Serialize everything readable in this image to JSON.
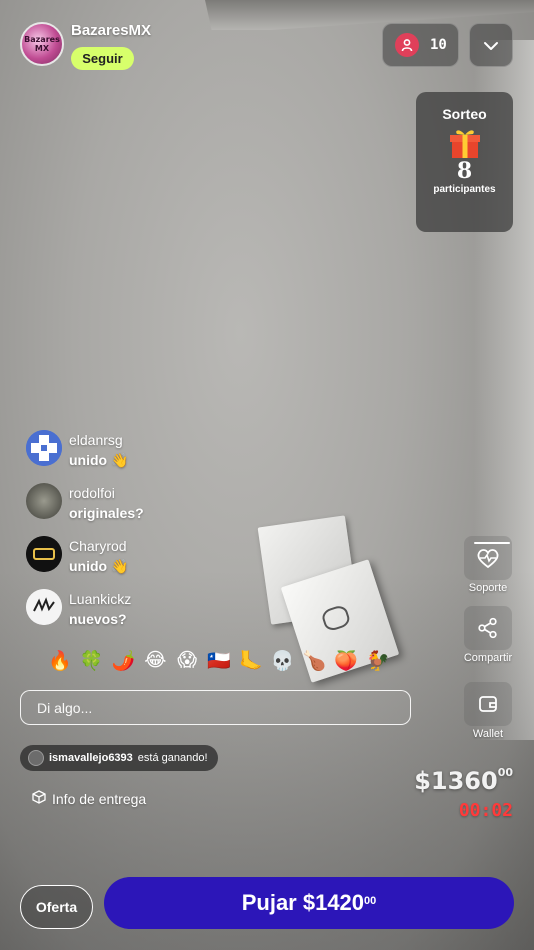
{
  "stream": {
    "host_name": "BazaresMX",
    "host_avatar_text": "Bazares MX",
    "follow_label": "Seguir",
    "viewer_count": "10"
  },
  "giveaway": {
    "title": "Sorteo",
    "icon": "gift-icon",
    "participants_count": "8",
    "participants_label": "participantes"
  },
  "chat": [
    {
      "user": "eldanrsg",
      "text": "unido 👋",
      "avatar": "blue-cross"
    },
    {
      "user": "rodolfoi",
      "text": "originales?",
      "avatar": "photo"
    },
    {
      "user": "Charyrod",
      "text": "unido 👋",
      "avatar": "rd-logo"
    },
    {
      "user": "Luankickz",
      "text": "nuevos?",
      "avatar": "white-logo"
    }
  ],
  "reactions": [
    "🔥",
    "🍀",
    "🌶️",
    "😂",
    "😱",
    "🇨🇱",
    "🦶",
    "💀",
    "🍗",
    "🍑",
    "🐓"
  ],
  "input": {
    "placeholder": "Di algo..."
  },
  "winner": {
    "user": "ismavallejo6393",
    "text": "está ganando!"
  },
  "delivery_label": "Info de entrega",
  "side_actions": [
    {
      "label": "Soporte",
      "icon": "heart-pulse-icon"
    },
    {
      "label": "Compartir",
      "icon": "share-icon"
    },
    {
      "label": "Wallet",
      "icon": "wallet-icon"
    }
  ],
  "auction": {
    "current_price": "$1360",
    "current_cents": "00",
    "timer": "00:02",
    "offer_label": "Oferta",
    "bid_label": "Pujar $1420",
    "bid_cents": "00"
  },
  "colors": {
    "follow_bg": "#d7ff6b",
    "bid_bg": "#2c16b8",
    "timer": "#ff3a3a",
    "viewer_dot": "#e0405a"
  }
}
